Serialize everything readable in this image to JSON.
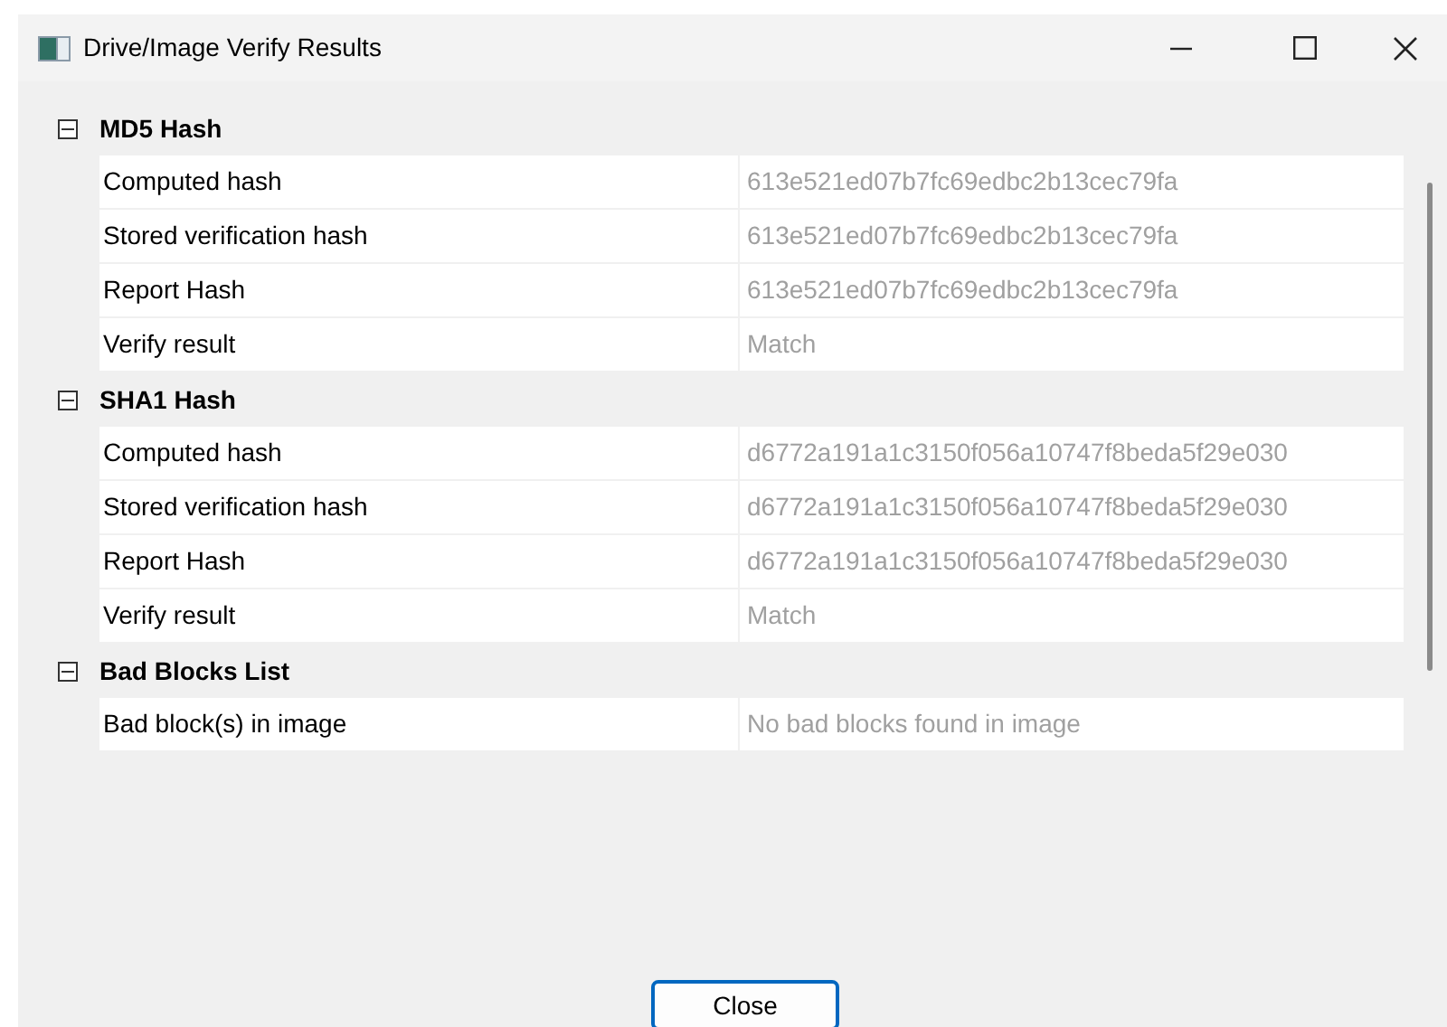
{
  "window": {
    "title": "Drive/Image Verify Results"
  },
  "sections": [
    {
      "title": "MD5 Hash",
      "expanded": true,
      "rows": [
        {
          "label": "Computed hash",
          "value": "613e521ed07b7fc69edbc2b13cec79fa"
        },
        {
          "label": "Stored verification hash",
          "value": "613e521ed07b7fc69edbc2b13cec79fa"
        },
        {
          "label": "Report Hash",
          "value": "613e521ed07b7fc69edbc2b13cec79fa"
        },
        {
          "label": "Verify result",
          "value": "Match"
        }
      ]
    },
    {
      "title": "SHA1 Hash",
      "expanded": true,
      "rows": [
        {
          "label": "Computed hash",
          "value": "d6772a191a1c3150f056a10747f8beda5f29e030"
        },
        {
          "label": "Stored verification hash",
          "value": "d6772a191a1c3150f056a10747f8beda5f29e030"
        },
        {
          "label": "Report Hash",
          "value": "d6772a191a1c3150f056a10747f8beda5f29e030"
        },
        {
          "label": "Verify result",
          "value": "Match"
        }
      ]
    },
    {
      "title": "Bad Blocks List",
      "expanded": true,
      "rows": [
        {
          "label": "Bad block(s) in image",
          "value": "No bad blocks found in image"
        }
      ]
    }
  ],
  "buttons": [
    "Close"
  ]
}
